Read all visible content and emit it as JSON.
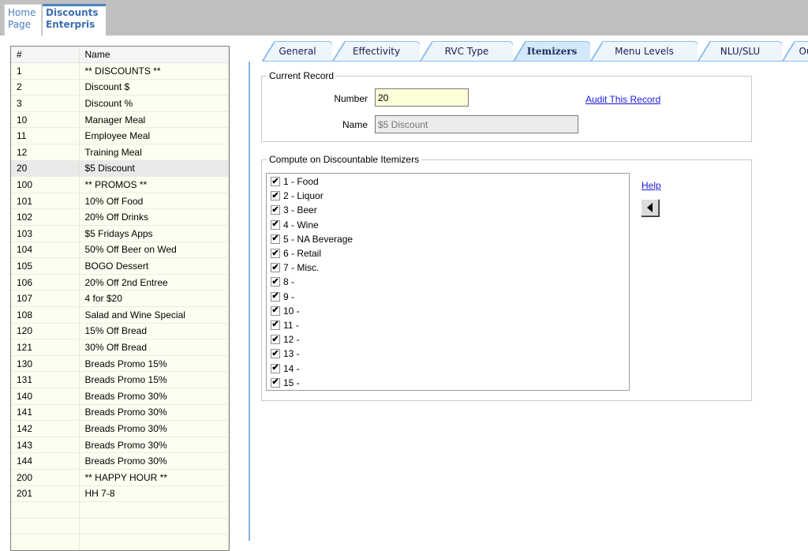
{
  "doc_tabs": [
    {
      "line1": "Home",
      "line2": "Page",
      "active": false
    },
    {
      "line1": "Discounts",
      "line2": "Enterpris",
      "active": true
    }
  ],
  "list": {
    "headers": [
      "#",
      "Name"
    ],
    "selected_number": "20",
    "rows": [
      {
        "num": "1",
        "name": "** DISCOUNTS **"
      },
      {
        "num": "2",
        "name": "Discount $"
      },
      {
        "num": "3",
        "name": "Discount %"
      },
      {
        "num": "10",
        "name": "Manager Meal"
      },
      {
        "num": "11",
        "name": "Employee Meal"
      },
      {
        "num": "12",
        "name": "Training Meal"
      },
      {
        "num": "20",
        "name": "$5 Discount"
      },
      {
        "num": "100",
        "name": "** PROMOS **"
      },
      {
        "num": "101",
        "name": "10% Off Food"
      },
      {
        "num": "102",
        "name": "20% Off Drinks"
      },
      {
        "num": "103",
        "name": "$5 Fridays Apps"
      },
      {
        "num": "104",
        "name": "50% Off Beer on Wed"
      },
      {
        "num": "105",
        "name": "BOGO Dessert"
      },
      {
        "num": "106",
        "name": "20% Off 2nd Entree"
      },
      {
        "num": "107",
        "name": "4 for $20"
      },
      {
        "num": "108",
        "name": "Salad and Wine Special"
      },
      {
        "num": "120",
        "name": "15% Off Bread"
      },
      {
        "num": "121",
        "name": "30% Off Bread"
      },
      {
        "num": "130",
        "name": "Breads Promo 15%"
      },
      {
        "num": "131",
        "name": "Breads Promo 15%"
      },
      {
        "num": "140",
        "name": "Breads Promo 30%"
      },
      {
        "num": "141",
        "name": "Breads Promo 30%"
      },
      {
        "num": "142",
        "name": "Breads Promo 30%"
      },
      {
        "num": "143",
        "name": "Breads Promo 30%"
      },
      {
        "num": "144",
        "name": "Breads Promo 30%"
      },
      {
        "num": "200",
        "name": "** HAPPY HOUR **"
      },
      {
        "num": "201",
        "name": "HH 7-8"
      },
      {
        "num": "",
        "name": ""
      },
      {
        "num": "",
        "name": ""
      },
      {
        "num": "",
        "name": ""
      }
    ]
  },
  "tabs": [
    {
      "label": "General",
      "active": false
    },
    {
      "label": "Effectivity",
      "active": false
    },
    {
      "label": "RVC Type",
      "active": false
    },
    {
      "label": "Itemizers",
      "active": true
    },
    {
      "label": "Menu Levels",
      "active": false
    },
    {
      "label": "NLU/SLU",
      "active": false
    },
    {
      "label": "Ou",
      "active": false
    }
  ],
  "current_record": {
    "legend": "Current Record",
    "number_label": "Number",
    "number_value": "20",
    "name_label": "Name",
    "name_value": "$5 Discount",
    "audit_link": "Audit This Record"
  },
  "itemizers": {
    "legend": "Compute on Discountable Itemizers",
    "help_link": "Help",
    "items": [
      {
        "label": "1 - Food",
        "checked": true
      },
      {
        "label": "2 - Liquor",
        "checked": true
      },
      {
        "label": "3 - Beer",
        "checked": true
      },
      {
        "label": "4 - Wine",
        "checked": true
      },
      {
        "label": "5 - NA Beverage",
        "checked": true
      },
      {
        "label": "6 - Retail",
        "checked": true
      },
      {
        "label": "7 - Misc.",
        "checked": true
      },
      {
        "label": "8 -",
        "checked": true
      },
      {
        "label": "9 -",
        "checked": true
      },
      {
        "label": "10 -",
        "checked": true
      },
      {
        "label": "11 -",
        "checked": true
      },
      {
        "label": "12 -",
        "checked": true
      },
      {
        "label": "13 -",
        "checked": true
      },
      {
        "label": "14 -",
        "checked": true
      },
      {
        "label": "15 -",
        "checked": true
      }
    ]
  },
  "icons": {
    "check": "✔",
    "collapse_arrow": "triangle-left"
  }
}
